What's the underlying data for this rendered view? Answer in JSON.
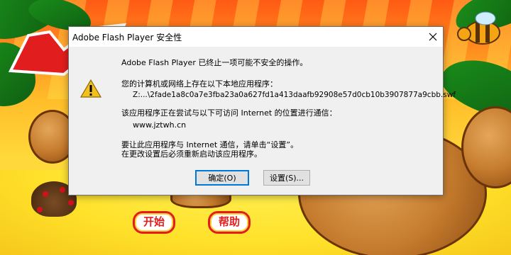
{
  "scene": {
    "game_buttons": {
      "start": "开始",
      "help": "帮助"
    }
  },
  "dialog": {
    "title": "Adobe Flash Player 安全性",
    "message": "Adobe Flash Player 已终止一项可能不安全的操作。",
    "local_app_label": "您的计算机或网络上存在以下本地应用程序：",
    "file_path": "Z:...\\2fade1a8c0a7e3fba23a0a627fd1a413daafb92908e57d0cb10b3907877a9cbb.swf",
    "internet_label": "该应用程序正在尝试与以下可访问 Internet 的位置进行通信：",
    "url": "www.jztwh.cn",
    "instruction_1": "要让此应用程序与 Internet 通信，请单击“设置”。",
    "instruction_2": "在更改设置后必须重新启动该应用程序。",
    "buttons": {
      "ok": "确定(O)",
      "settings": "设置(S)..."
    }
  },
  "colors": {
    "accent": "#0078d7",
    "warning": "#f2c11d",
    "game_red": "#e21d1d"
  },
  "icons": {
    "dialog": "warning-icon",
    "titlebar_close": "close-icon"
  }
}
